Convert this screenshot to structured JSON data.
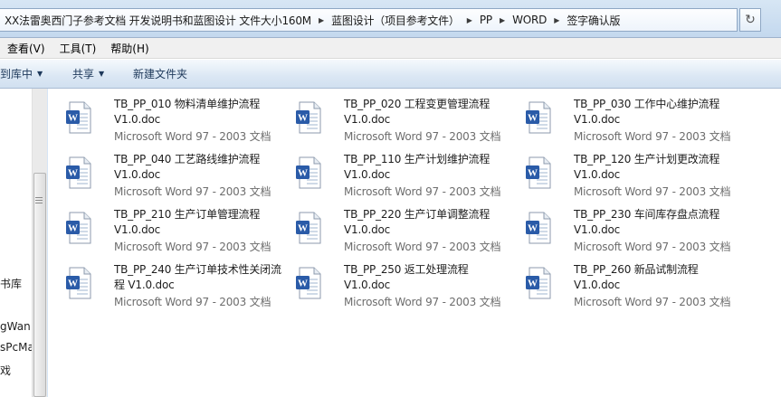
{
  "address_bar": {
    "crumbs": [
      "XX法雷奥西门子参考文档 开发说明书和蓝图设计 文件大小160M",
      "蓝图设计（项目参考文件）",
      "PP",
      "WORD",
      "签字确认版"
    ],
    "refresh_glyph": "↻"
  },
  "menu_bar": {
    "items": [
      "查看(V)",
      "工具(T)",
      "帮助(H)"
    ]
  },
  "command_bar": {
    "library": "到库中",
    "share": "共享",
    "new_folder": "新建文件夹",
    "dropdown_glyph": "▼"
  },
  "nav_pane": {
    "items": [
      "书库",
      "gWan",
      "sPcMa",
      "戏"
    ]
  },
  "files": [
    {
      "name": "TB_PP_010 物料清单维护流程 V1.0.doc",
      "type": "Microsoft Word 97 - 2003 文档"
    },
    {
      "name": "TB_PP_020 工程变更管理流程 V1.0.doc",
      "type": "Microsoft Word 97 - 2003 文档"
    },
    {
      "name": "TB_PP_030 工作中心维护流程 V1.0.doc",
      "type": "Microsoft Word 97 - 2003 文档"
    },
    {
      "name": "TB_PP_040 工艺路线维护流程 V1.0.doc",
      "type": "Microsoft Word 97 - 2003 文档"
    },
    {
      "name": "TB_PP_110 生产计划维护流程 V1.0.doc",
      "type": "Microsoft Word 97 - 2003 文档"
    },
    {
      "name": "TB_PP_120 生产计划更改流程 V1.0.doc",
      "type": "Microsoft Word 97 - 2003 文档"
    },
    {
      "name": "TB_PP_210 生产订单管理流程 V1.0.doc",
      "type": "Microsoft Word 97 - 2003 文档"
    },
    {
      "name": "TB_PP_220 生产订单调整流程 V1.0.doc",
      "type": "Microsoft Word 97 - 2003 文档"
    },
    {
      "name": "TB_PP_230 车间库存盘点流程 V1.0.doc",
      "type": "Microsoft Word 97 - 2003 文档"
    },
    {
      "name": "TB_PP_240 生产订单技术性关闭流程 V1.0.doc",
      "type": "Microsoft Word 97 - 2003 文档"
    },
    {
      "name": "TB_PP_250 返工处理流程 V1.0.doc",
      "type": "Microsoft Word 97 - 2003 文档"
    },
    {
      "name": "TB_PP_260 新品试制流程 V1.0.doc",
      "type": "Microsoft Word 97 - 2003 文档"
    }
  ],
  "icons": {
    "file_icon": "word-document-icon",
    "word_badge_letter": "W",
    "word_badge_color": "#2a5ba8"
  }
}
